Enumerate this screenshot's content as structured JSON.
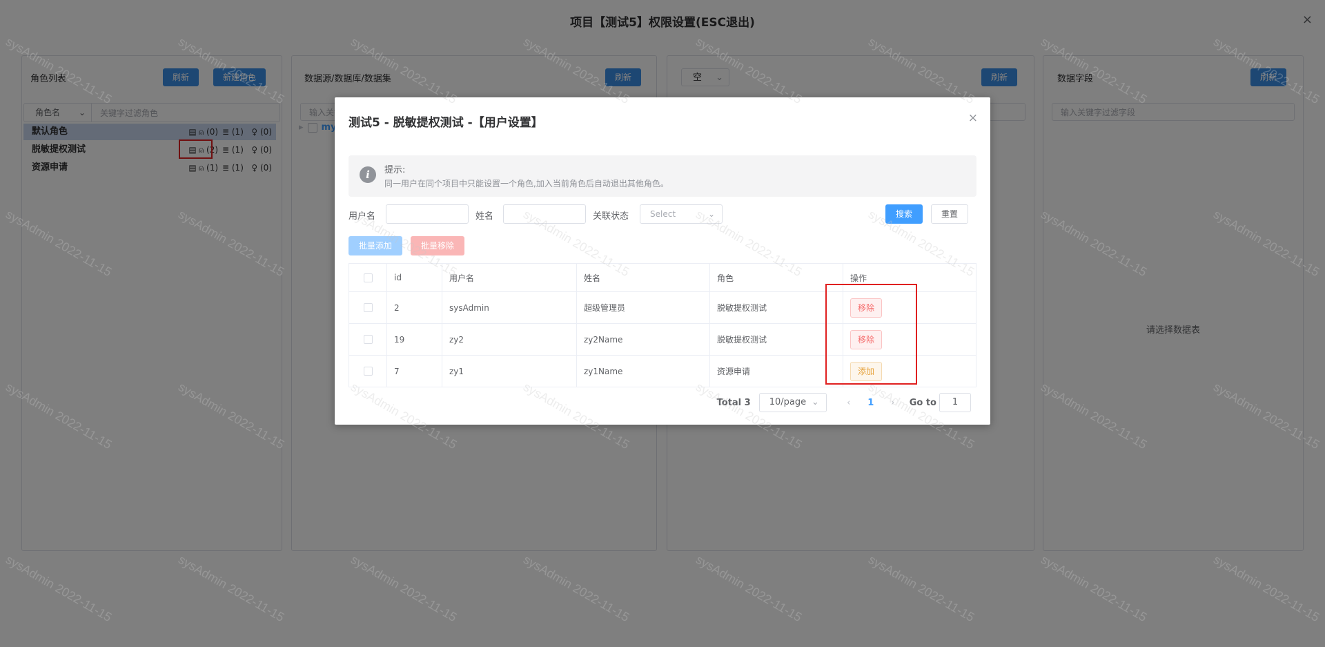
{
  "page": {
    "title": "项目【测试5】权限设置(ESC退出)",
    "close_icon": "×"
  },
  "roles_panel": {
    "title": "角色列表",
    "refresh": "刷新",
    "new_role": "新建角色",
    "filter_select": "角色名",
    "filter_placeholder": "关键字过滤角色",
    "roles": [
      {
        "name": "默认角色",
        "users": "(0)",
        "dbs": "(1)",
        "tips": "(0)"
      },
      {
        "name": "脱敏提权测试",
        "users": "(2)",
        "dbs": "(1)",
        "tips": "(0)"
      },
      {
        "name": "资源申请",
        "users": "(1)",
        "dbs": "(1)",
        "tips": "(0)"
      }
    ]
  },
  "datasource_panel": {
    "title": "数据源/数据库/数据集",
    "refresh": "刷新",
    "search_placeholder": "输入关键",
    "tree_node": "my"
  },
  "table_panel": {
    "select_value": "空",
    "refresh": "刷新"
  },
  "fields_panel": {
    "title": "数据字段",
    "refresh": "刷新",
    "search_placeholder": "输入关键字过滤字段",
    "empty": "请选择数据表"
  },
  "watermark": "sysAdmin 2022-11-15",
  "dialog": {
    "title": "测试5 - 脱敏提权测试 -【用户设置】",
    "tip_title": "提示:",
    "tip_body": "同一用户在同个项目中只能设置一个角色,加入当前角色后自动退出其他角色。",
    "labels": {
      "username": "用户名",
      "name": "姓名",
      "status": "关联状态"
    },
    "status_placeholder": "Select",
    "search": "搜索",
    "reset": "重置",
    "batch_add": "批量添加",
    "batch_remove": "批量移除",
    "columns": [
      "id",
      "用户名",
      "姓名",
      "角色",
      "操作"
    ],
    "rows": [
      {
        "id": "2",
        "username": "sysAdmin",
        "name": "超级管理员",
        "role": "脱敏提权测试",
        "op": "移除",
        "op_type": "remove"
      },
      {
        "id": "19",
        "username": "zy2",
        "name": "zy2Name",
        "role": "脱敏提权测试",
        "op": "移除",
        "op_type": "remove"
      },
      {
        "id": "7",
        "username": "zy1",
        "name": "zy1Name",
        "role": "资源申请",
        "op": "添加",
        "op_type": "add"
      }
    ],
    "pagination": {
      "total": "Total 3",
      "page_size": "10/page",
      "current": "1",
      "goto_label": "Go to",
      "goto_value": "1"
    }
  },
  "colors": {
    "primary": "#409eff",
    "danger": "#f56c6c",
    "warning": "#e6a23c",
    "highlight": "#e02020"
  }
}
